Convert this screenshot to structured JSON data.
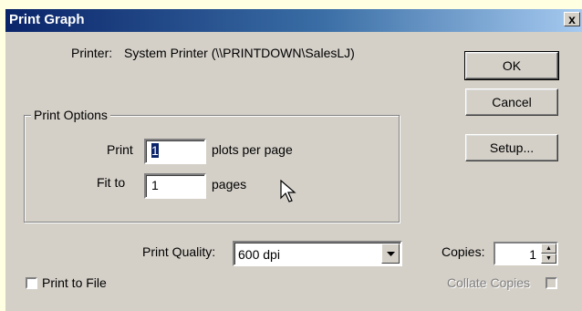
{
  "window": {
    "title": "Print Graph",
    "close_label": "x"
  },
  "printer": {
    "label": "Printer:",
    "value": "System Printer (\\\\PRINTDOWN\\SalesLJ)"
  },
  "buttons": {
    "ok": "OK",
    "cancel": "Cancel",
    "setup": "Setup..."
  },
  "print_options": {
    "title": "Print Options",
    "print_label": "Print",
    "print_value": "1",
    "plots_suffix": "plots per page",
    "fit_label": "Fit to",
    "fit_value": "1",
    "pages_suffix": "pages"
  },
  "quality": {
    "label": "Print Quality:",
    "value": "600 dpi"
  },
  "copies": {
    "label": "Copies:",
    "value": "1"
  },
  "print_to_file": {
    "label": "Print to File",
    "checked": false
  },
  "collate": {
    "label": "Collate Copies",
    "enabled": false,
    "checked": false
  },
  "icons": {
    "close": "close-icon",
    "dropdown": "chevron-down-icon",
    "spin_up": "arrow-up-icon",
    "spin_down": "arrow-down-icon",
    "pointer": "mouse-pointer-icon"
  },
  "colors": {
    "title_start": "#0a246a",
    "title_end": "#a6caf0",
    "dialog_bg": "#d4d0c8",
    "selection": "#0a246a",
    "page_bg": "#ffffe1"
  }
}
